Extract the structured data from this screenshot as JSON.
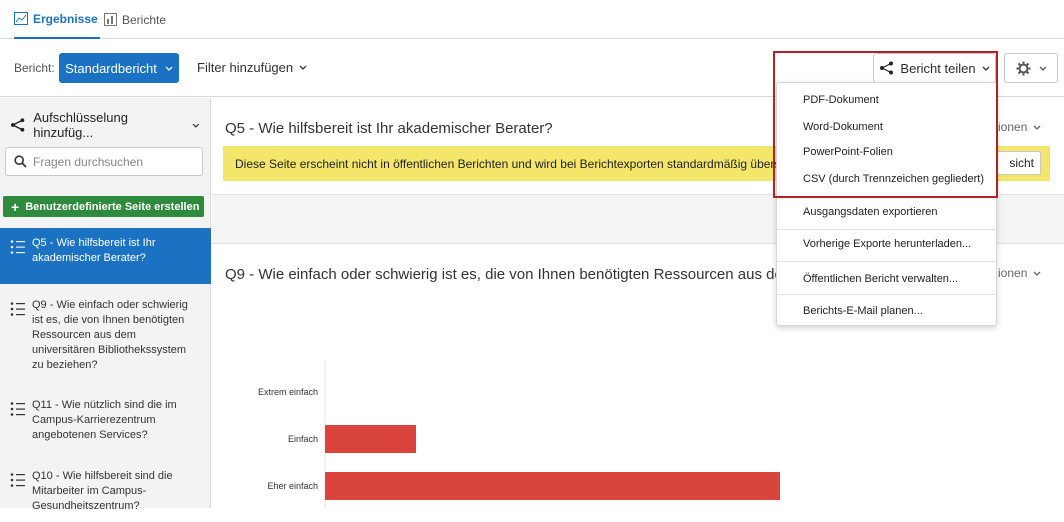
{
  "tabs": [
    {
      "label": "Ergebnisse",
      "icon": "chart-image-icon",
      "active": true
    },
    {
      "label": "Berichte",
      "icon": "bar-chart-icon",
      "active": false
    }
  ],
  "toolbar": {
    "report_label": "Bericht:",
    "report_select": "Standardbericht",
    "filter_add": "Filter hinzufügen",
    "share": "Bericht teilen"
  },
  "sidebar": {
    "breakdown": "Aufschlüsselung hinzufüg...",
    "search_placeholder": "Fragen durchsuchen",
    "create_page": "Benutzerdefinierte Seite erstellen",
    "questions": [
      {
        "text": "Q5 - Wie hilfsbereit ist Ihr akademischer Berater?"
      },
      {
        "text": "Q9 - Wie einfach oder schwierig ist es, die von Ihnen benötigten Ressourcen aus dem universitären Bibliothekssystem zu beziehen?"
      },
      {
        "text": "Q11 - Wie nützlich sind die im Campus-Karrierezentrum angebotenen Services?"
      },
      {
        "text": "Q10 - Wie hilfsbereit sind die Mitarbeiter im Campus-Gesundheitszentrum?"
      }
    ]
  },
  "main": {
    "q5_title": "Q5 - Wie hilfsbereit ist Ihr akademischer Berater?",
    "options_label": "ionen",
    "notice": "Diese Seite erscheint nicht in öffentlichen Berichten und wird bei Berichtexporten standardmäßig übersp",
    "notice_button": "sicht",
    "q9_title": "Q9 - Wie einfach oder schwierig ist es, die von Ihnen benötigten Ressourcen aus de"
  },
  "share_menu": {
    "items": [
      "PDF-Dokument",
      "Word-Dokument",
      "PowerPoint-Folien",
      "CSV (durch Trennzeichen gegliedert)",
      "Ausgangsdaten exportieren",
      "Vorherige Exporte herunterladen...",
      "Öffentlichen Bericht verwalten...",
      "Berichts-E-Mail planen..."
    ]
  },
  "colors": {
    "accent": "#1c72c2",
    "bar": "#d9443c",
    "notice": "#f3e66b",
    "create": "#2e8b3e",
    "highlight": "#b4202a"
  },
  "chart_data": {
    "type": "bar",
    "orientation": "horizontal",
    "categories": [
      "Extrem einfach",
      "Einfach",
      "Eher einfach"
    ],
    "values": [
      0,
      20,
      100
    ],
    "value_note": "values estimated relative to largest visible bar"
  }
}
